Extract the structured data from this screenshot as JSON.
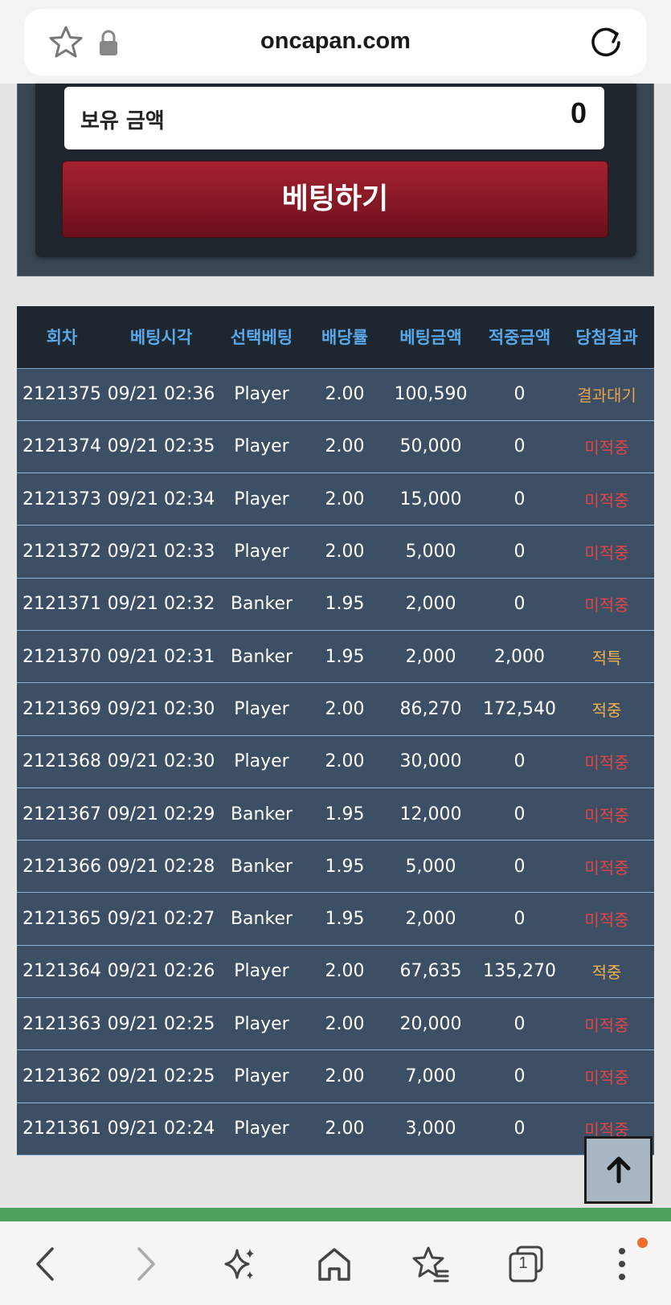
{
  "browser": {
    "url": "oncapan.com",
    "tab_count": "1"
  },
  "panel": {
    "balance_label": "보유 금액",
    "balance_value": "0",
    "bet_button": "베팅하기"
  },
  "table": {
    "headers": [
      "회차",
      "베팅시각",
      "선택베팅",
      "배당률",
      "베팅금액",
      "적중금액",
      "당첨결과"
    ],
    "rows": [
      {
        "round": "2121375",
        "time": "09/21 02:36",
        "pick": "Player",
        "odds": "2.00",
        "amount": "100,590",
        "win": "0",
        "result": "결과대기",
        "status": "wait"
      },
      {
        "round": "2121374",
        "time": "09/21 02:35",
        "pick": "Player",
        "odds": "2.00",
        "amount": "50,000",
        "win": "0",
        "result": "미적중",
        "status": "lose"
      },
      {
        "round": "2121373",
        "time": "09/21 02:34",
        "pick": "Player",
        "odds": "2.00",
        "amount": "15,000",
        "win": "0",
        "result": "미적중",
        "status": "lose"
      },
      {
        "round": "2121372",
        "time": "09/21 02:33",
        "pick": "Player",
        "odds": "2.00",
        "amount": "5,000",
        "win": "0",
        "result": "미적중",
        "status": "lose"
      },
      {
        "round": "2121371",
        "time": "09/21 02:32",
        "pick": "Banker",
        "odds": "1.95",
        "amount": "2,000",
        "win": "0",
        "result": "미적중",
        "status": "lose"
      },
      {
        "round": "2121370",
        "time": "09/21 02:31",
        "pick": "Banker",
        "odds": "1.95",
        "amount": "2,000",
        "win": "2,000",
        "result": "적특",
        "status": "win"
      },
      {
        "round": "2121369",
        "time": "09/21 02:30",
        "pick": "Player",
        "odds": "2.00",
        "amount": "86,270",
        "win": "172,540",
        "result": "적중",
        "status": "win"
      },
      {
        "round": "2121368",
        "time": "09/21 02:30",
        "pick": "Player",
        "odds": "2.00",
        "amount": "30,000",
        "win": "0",
        "result": "미적중",
        "status": "lose"
      },
      {
        "round": "2121367",
        "time": "09/21 02:29",
        "pick": "Banker",
        "odds": "1.95",
        "amount": "12,000",
        "win": "0",
        "result": "미적중",
        "status": "lose"
      },
      {
        "round": "2121366",
        "time": "09/21 02:28",
        "pick": "Banker",
        "odds": "1.95",
        "amount": "5,000",
        "win": "0",
        "result": "미적중",
        "status": "lose"
      },
      {
        "round": "2121365",
        "time": "09/21 02:27",
        "pick": "Banker",
        "odds": "1.95",
        "amount": "2,000",
        "win": "0",
        "result": "미적중",
        "status": "lose"
      },
      {
        "round": "2121364",
        "time": "09/21 02:26",
        "pick": "Player",
        "odds": "2.00",
        "amount": "67,635",
        "win": "135,270",
        "result": "적중",
        "status": "win"
      },
      {
        "round": "2121363",
        "time": "09/21 02:25",
        "pick": "Player",
        "odds": "2.00",
        "amount": "20,000",
        "win": "0",
        "result": "미적중",
        "status": "lose"
      },
      {
        "round": "2121362",
        "time": "09/21 02:25",
        "pick": "Player",
        "odds": "2.00",
        "amount": "7,000",
        "win": "0",
        "result": "미적중",
        "status": "lose"
      },
      {
        "round": "2121361",
        "time": "09/21 02:24",
        "pick": "Player",
        "odds": "2.00",
        "amount": "3,000",
        "win": "0",
        "result": "미적중",
        "status": "lose"
      }
    ]
  },
  "colors": {
    "header_text": "#5aa8ea",
    "result_wait": "#e8a24c",
    "result_lose": "#e64545",
    "result_win": "#f2b24e",
    "bet_button": "#8e1a27",
    "bottom_line": "#4ea35c"
  },
  "icons": {
    "bookmark": "star-outline-icon",
    "security": "lock-icon",
    "reload": "reload-icon",
    "scroll_top": "arrow-up-icon",
    "nav_back": "chevron-left-icon",
    "nav_forward": "chevron-right-icon",
    "ai": "sparkles-icon",
    "home": "home-icon",
    "bookmarks": "star-list-icon",
    "tabs": "tabs-icon",
    "menu": "more-vertical-icon"
  }
}
